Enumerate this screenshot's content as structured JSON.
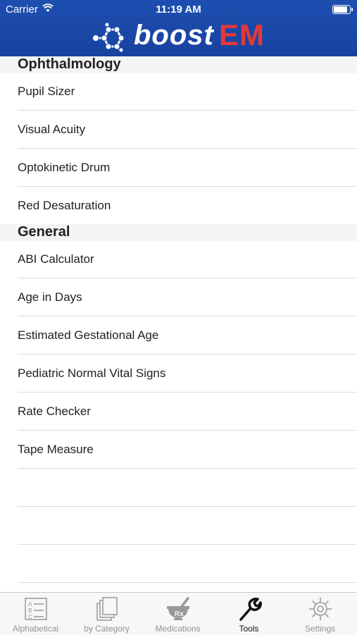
{
  "status_bar": {
    "carrier": "Carrier",
    "time": "11:19 AM"
  },
  "header": {
    "logo_word1": "boost",
    "logo_word2": "EM",
    "colors": {
      "bar": "#1d4fb0",
      "em": "#e23a3a"
    }
  },
  "sections": [
    {
      "title": "Ophthalmology",
      "items": [
        "Pupil Sizer",
        "Visual Acuity",
        "Optokinetic Drum",
        "Red Desaturation"
      ]
    },
    {
      "title": "General",
      "items": [
        "ABI Calculator",
        "Age in Days",
        "Estimated Gestational Age",
        "Pediatric Normal Vital Signs",
        "Rate Checker",
        "Tape Measure"
      ]
    }
  ],
  "tabbar": {
    "tabs": [
      {
        "label": "Alphabetical",
        "icon": "alphabetical-list-icon"
      },
      {
        "label": "by Category",
        "icon": "category-stack-icon"
      },
      {
        "label": "Medications",
        "icon": "mortar-pestle-rx-icon"
      },
      {
        "label": "Tools",
        "icon": "wrench-icon",
        "active": true
      },
      {
        "label": "Settings",
        "icon": "gear-icon"
      }
    ]
  }
}
